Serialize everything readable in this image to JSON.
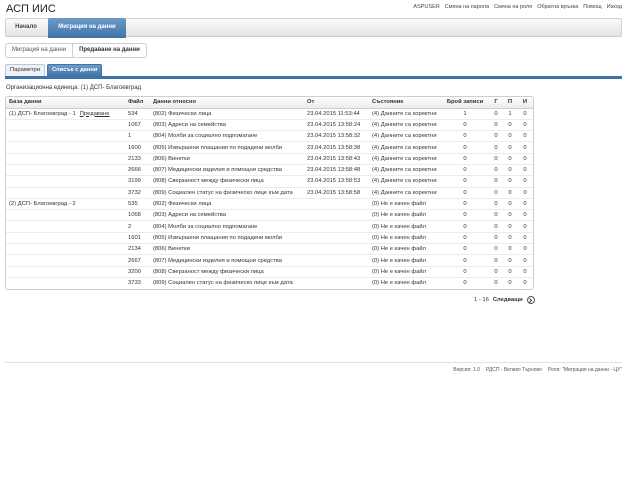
{
  "app": {
    "title": "АСП ИИС"
  },
  "top_links": [
    {
      "name": "user-link",
      "label": "ASPUSER"
    },
    {
      "name": "change-password-link",
      "label": "Смяна на парола"
    },
    {
      "name": "change-role-link",
      "label": "Смяна на роля"
    },
    {
      "name": "feedback-link",
      "label": "Обратна връзка"
    },
    {
      "name": "help-link",
      "label": "Помощ"
    },
    {
      "name": "logout-link",
      "label": "Изход"
    }
  ],
  "nav": {
    "home": "Начало",
    "migration": "Миграция на данни"
  },
  "breadcrumb": {
    "parent": "Миграция на данни",
    "current": "Предаване на данни"
  },
  "tabs": {
    "params": "Параметри",
    "list": "Списък с данни"
  },
  "org_unit": "Организационна единица: (1) ДСП- Благоевград",
  "table": {
    "headers": {
      "database": "База данни",
      "file": "Файл",
      "data_about": "Данни относно",
      "from": "От",
      "status": "Състояние",
      "count": "Брой записи",
      "g": "Г",
      "p": "П",
      "i": "И"
    },
    "rows": [
      {
        "database": "(1) ДСП- Благоевград - 1",
        "link": "Предаване",
        "file": "534",
        "data_about": "(802) Физически лица",
        "from": "23.04.2015 11:53:44",
        "status": "(4) Данните са коректни",
        "count": "1",
        "g": "0",
        "p": "1",
        "i": "0"
      },
      {
        "database": "",
        "link": "",
        "file": "1067",
        "data_about": "(803) Адреси на семейства",
        "from": "23.04.2015 13:58:24",
        "status": "(4) Данните са коректни",
        "count": "0",
        "g": "0",
        "p": "0",
        "i": "0"
      },
      {
        "database": "",
        "link": "",
        "file": "1",
        "data_about": "(804) Молби за социално подпомагане",
        "from": "23.04.2015 13:58:32",
        "status": "(4) Данните са коректни",
        "count": "0",
        "g": "0",
        "p": "0",
        "i": "0"
      },
      {
        "database": "",
        "link": "",
        "file": "1600",
        "data_about": "(805) Извършени плащания по подадени молби",
        "from": "23.04.2015 13:58:38",
        "status": "(4) Данните са коректни",
        "count": "0",
        "g": "0",
        "p": "0",
        "i": "0"
      },
      {
        "database": "",
        "link": "",
        "file": "2133",
        "data_about": "(806) Винетки",
        "from": "23.04.2015 13:58:43",
        "status": "(4) Данните са коректни",
        "count": "0",
        "g": "0",
        "p": "0",
        "i": "0"
      },
      {
        "database": "",
        "link": "",
        "file": "2666",
        "data_about": "(807) Медицински изделия и помощни средства",
        "from": "23.04.2015 13:58:48",
        "status": "(4) Данните са коректни",
        "count": "0",
        "g": "0",
        "p": "0",
        "i": "0"
      },
      {
        "database": "",
        "link": "",
        "file": "3199",
        "data_about": "(808) Сверзаност между физически лица",
        "from": "23.04.2015 13:58:53",
        "status": "(4) Данните са коректни",
        "count": "0",
        "g": "0",
        "p": "0",
        "i": "0"
      },
      {
        "database": "",
        "link": "",
        "file": "3732",
        "data_about": "(809) Социален статус на физическо лице към дата",
        "from": "23.04.2015 13:58:58",
        "status": "(4) Данните са коректни",
        "count": "0",
        "g": "0",
        "p": "0",
        "i": "0"
      },
      {
        "database": "(2) ДСП- Благоевград - 2",
        "link": "",
        "file": "535",
        "data_about": "(802) Физически лица",
        "from": "",
        "status": "(0) Не е качен файл",
        "count": "0",
        "g": "0",
        "p": "0",
        "i": "0"
      },
      {
        "database": "",
        "link": "",
        "file": "1068",
        "data_about": "(803) Адреси на семейства",
        "from": "",
        "status": "(0) Не е качен файл",
        "count": "0",
        "g": "0",
        "p": "0",
        "i": "0"
      },
      {
        "database": "",
        "link": "",
        "file": "2",
        "data_about": "(804) Молби за социално подпомагане",
        "from": "",
        "status": "(0) Не е качен файл",
        "count": "0",
        "g": "0",
        "p": "0",
        "i": "0"
      },
      {
        "database": "",
        "link": "",
        "file": "1601",
        "data_about": "(805) Извършени плащания по подадени молби",
        "from": "",
        "status": "(0) Не е качен файл",
        "count": "0",
        "g": "0",
        "p": "0",
        "i": "0"
      },
      {
        "database": "",
        "link": "",
        "file": "2134",
        "data_about": "(806) Винетки",
        "from": "",
        "status": "(0) Не е качен файл",
        "count": "0",
        "g": "0",
        "p": "0",
        "i": "0"
      },
      {
        "database": "",
        "link": "",
        "file": "2667",
        "data_about": "(807) Медицински изделия и помощни средства",
        "from": "",
        "status": "(0) Не е качен файл",
        "count": "0",
        "g": "0",
        "p": "0",
        "i": "0"
      },
      {
        "database": "",
        "link": "",
        "file": "3200",
        "data_about": "(808) Сверзаност между физически лица",
        "from": "",
        "status": "(0) Не е качен файл",
        "count": "0",
        "g": "0",
        "p": "0",
        "i": "0"
      },
      {
        "database": "",
        "link": "",
        "file": "3733",
        "data_about": "(809) Социален статус на физическо лице към дата",
        "from": "",
        "status": "(0) Не е качен файл",
        "count": "0",
        "g": "0",
        "p": "0",
        "i": "0"
      }
    ]
  },
  "pager": {
    "range": "1 - 16",
    "next": "Следващи",
    "next_icon": "chevron-right-icon"
  },
  "footer": {
    "version": "Версия: 1.0",
    "rdsp": "РДСП - Велико Търново",
    "role": "Роля: \"Миграция на данни - ЦУ\""
  },
  "colors": {
    "accent": "#3f74a8",
    "accent_light": "#6d9bc8"
  }
}
